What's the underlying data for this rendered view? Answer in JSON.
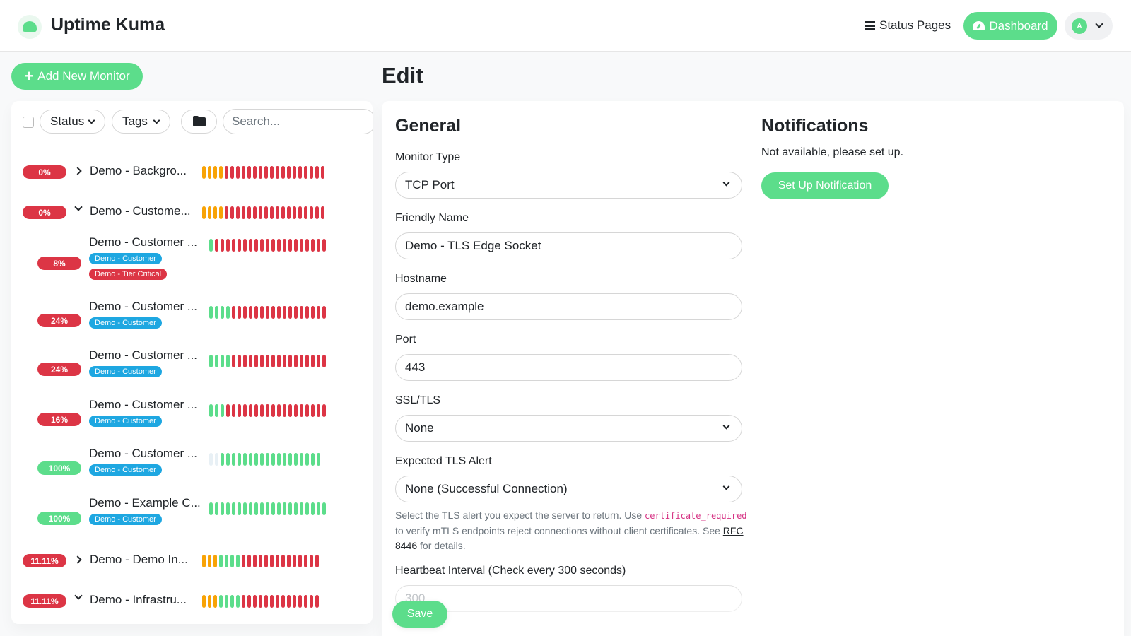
{
  "header": {
    "brand": "Uptime Kuma",
    "status_pages": "Status Pages",
    "dashboard": "Dashboard",
    "avatar_initial": "A"
  },
  "sidebar": {
    "add_button": "Add New Monitor",
    "status_filter": "Status",
    "tags_filter": "Tags",
    "search_placeholder": "Search..."
  },
  "monitors": [
    {
      "uptime": "0%",
      "name": "Demo - Backgro...",
      "group": true,
      "expanded": false
    },
    {
      "uptime": "0%",
      "name": "Demo - Custome...",
      "group": true,
      "expanded": true
    },
    {
      "uptime": "8%",
      "name": "Demo - Customer ...",
      "tags": [
        "Demo - Customer",
        "Demo - Tier Critical"
      ]
    },
    {
      "uptime": "24%",
      "name": "Demo - Customer ...",
      "tags": [
        "Demo - Customer"
      ]
    },
    {
      "uptime": "24%",
      "name": "Demo - Customer ...",
      "tags": [
        "Demo - Customer"
      ]
    },
    {
      "uptime": "16%",
      "name": "Demo - Customer ...",
      "tags": [
        "Demo - Customer"
      ]
    },
    {
      "uptime": "100%",
      "name": "Demo - Customer ...",
      "tags": [
        "Demo - Customer"
      ]
    },
    {
      "uptime": "100%",
      "name": "Demo - Example C...",
      "tags": [
        "Demo - Customer"
      ]
    },
    {
      "uptime": "11.11%",
      "name": "Demo - Demo In...",
      "group": true,
      "expanded": false
    },
    {
      "uptime": "11.11%",
      "name": "Demo - Infrastru...",
      "group": true,
      "expanded": true
    }
  ],
  "page": {
    "title": "Edit"
  },
  "general": {
    "heading": "General",
    "monitor_type_label": "Monitor Type",
    "monitor_type_value": "TCP Port",
    "friendly_name_label": "Friendly Name",
    "friendly_name_value": "Demo - TLS Edge Socket",
    "hostname_label": "Hostname",
    "hostname_value": "demo.example",
    "port_label": "Port",
    "port_value": "443",
    "ssl_label": "SSL/TLS",
    "ssl_value": "None",
    "tls_alert_label": "Expected TLS Alert",
    "tls_alert_value": "None (Successful Connection)",
    "help_1": "Select the TLS alert you expect the server to return. Use",
    "help_code": "certificate_required",
    "help_2": " to verify mTLS endpoints reject connections without client certificates. See ",
    "help_link": "RFC 8446",
    "help_3": " for details.",
    "heartbeat_label": "Heartbeat Interval (Check every 300 seconds)",
    "heartbeat_value": "300",
    "save": "Save"
  },
  "notifications": {
    "heading": "Notifications",
    "not_available": "Not available, please set up.",
    "setup_button": "Set Up Notification"
  },
  "colors": {
    "accent": "#5cdd8b",
    "down": "#dc3545",
    "pending": "#f8a306",
    "tag_customer": "#1ea7e1",
    "tag_critical": "#dc3545"
  }
}
